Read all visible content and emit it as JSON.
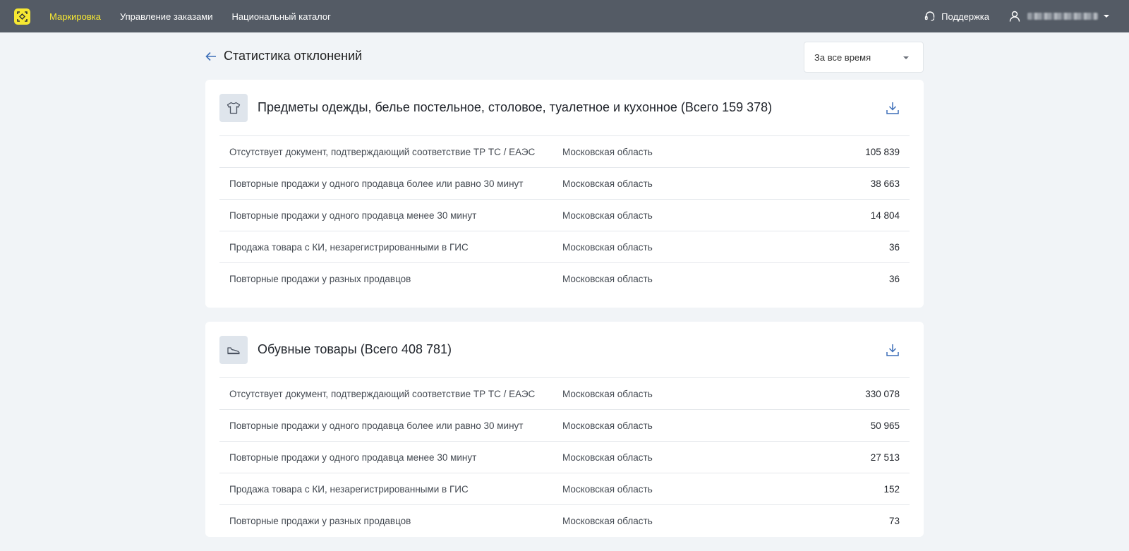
{
  "topbar": {
    "nav": [
      {
        "label": "Маркировка",
        "active": true
      },
      {
        "label": "Управление заказами",
        "active": false
      },
      {
        "label": "Национальный каталог",
        "active": false
      }
    ],
    "support_label": "Поддержка",
    "accent_color": "#f7e832",
    "bar_color": "#545b65"
  },
  "page": {
    "title": "Статистика отклонений",
    "period": "За все время"
  },
  "categories": [
    {
      "icon": "tshirt-icon",
      "title": "Предметы одежды, белье постельное, столовое, туалетное и кухонное (Всего 159 378)",
      "rows": [
        {
          "reason": "Отсутствует документ, подтверждающий соответствие ТР ТС / ЕАЭС",
          "region": "Московская область",
          "count": "105 839"
        },
        {
          "reason": "Повторные продажи у одного продавца более или равно 30 минут",
          "region": "Московская область",
          "count": "38 663"
        },
        {
          "reason": "Повторные продажи у одного продавца менее 30 минут",
          "region": "Московская область",
          "count": "14 804"
        },
        {
          "reason": "Продажа товара с КИ, незарегистрированными в ГИС",
          "region": "Московская область",
          "count": "36"
        },
        {
          "reason": "Повторные продажи у разных продавцов",
          "region": "Московская область",
          "count": "36"
        }
      ]
    },
    {
      "icon": "shoe-icon",
      "title": "Обувные товары (Всего 408 781)",
      "rows": [
        {
          "reason": "Отсутствует документ, подтверждающий соответствие ТР ТС / ЕАЭС",
          "region": "Московская область",
          "count": "330 078"
        },
        {
          "reason": "Повторные продажи у одного продавца более или равно 30 минут",
          "region": "Московская область",
          "count": "50 965"
        },
        {
          "reason": "Повторные продажи у одного продавца менее 30 минут",
          "region": "Московская область",
          "count": "27 513"
        },
        {
          "reason": "Продажа товара с КИ, незарегистрированными в ГИС",
          "region": "Московская область",
          "count": "152"
        },
        {
          "reason": "Повторные продажи у разных продавцов",
          "region": "Московская область",
          "count": "73"
        }
      ]
    }
  ]
}
